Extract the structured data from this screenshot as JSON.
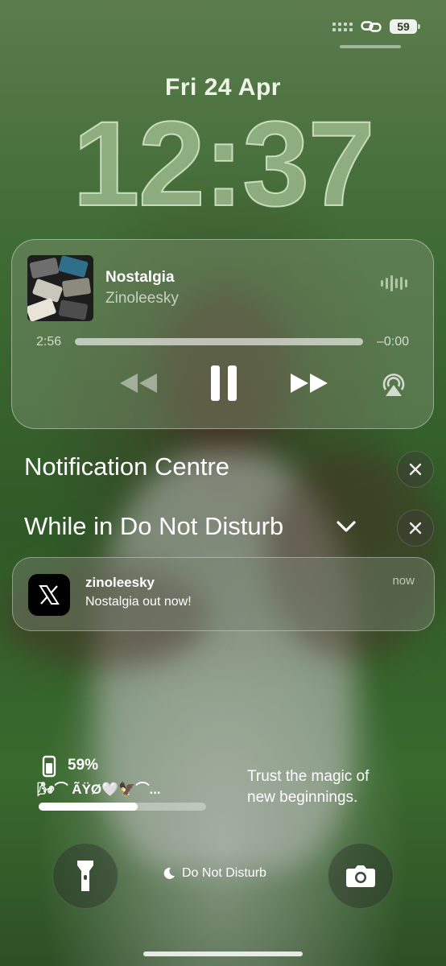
{
  "status_bar": {
    "battery_level": "59"
  },
  "lock_screen": {
    "date": "Fri 24 Apr",
    "time": "12:37"
  },
  "now_playing": {
    "title": "Nostalgia",
    "artist": "Zinoleesky",
    "elapsed": "2:56",
    "remaining": "–0:00",
    "progress_fraction": 1.0
  },
  "notification_centre": {
    "title": "Notification Centre",
    "focus_label": "While in Do Not Disturb"
  },
  "notification": {
    "app": "zinoleesky",
    "body": "Nostalgia out now!",
    "time": "now"
  },
  "battery_widget": {
    "percent": "59%",
    "device_name": "🌬︎⌒ ÃŸØ🤍🦅⌒...",
    "fill_fraction": 0.59
  },
  "quote": {
    "line1": "Trust the magic of",
    "line2": "new beginnings."
  },
  "focus_pill": {
    "label": "Do Not Disturb"
  }
}
